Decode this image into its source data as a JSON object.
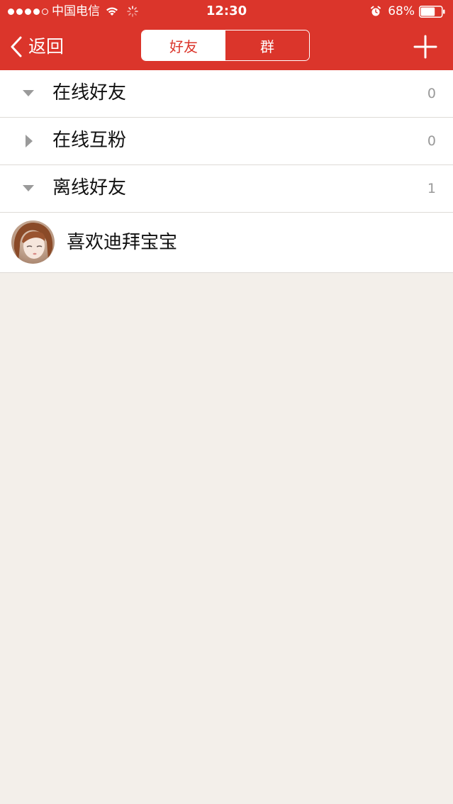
{
  "status_bar": {
    "carrier": "中国电信",
    "signal_bars_filled": 4,
    "signal_bars_total": 5,
    "time": "12:30",
    "battery_percent": "68%",
    "battery_level": 0.68
  },
  "nav": {
    "back_label": "返回",
    "tabs": [
      {
        "label": "好友",
        "active": true
      },
      {
        "label": "群",
        "active": false
      }
    ]
  },
  "groups": [
    {
      "label": "在线好友",
      "count": "0",
      "expanded": true
    },
    {
      "label": "在线互粉",
      "count": "0",
      "expanded": false
    },
    {
      "label": "离线好友",
      "count": "1",
      "expanded": true
    }
  ],
  "friends": [
    {
      "name": "喜欢迪拜宝宝"
    }
  ],
  "colors": {
    "accent": "#db352b",
    "background": "#f3efea",
    "divider": "#dedbd7",
    "muted_text": "#999999"
  }
}
